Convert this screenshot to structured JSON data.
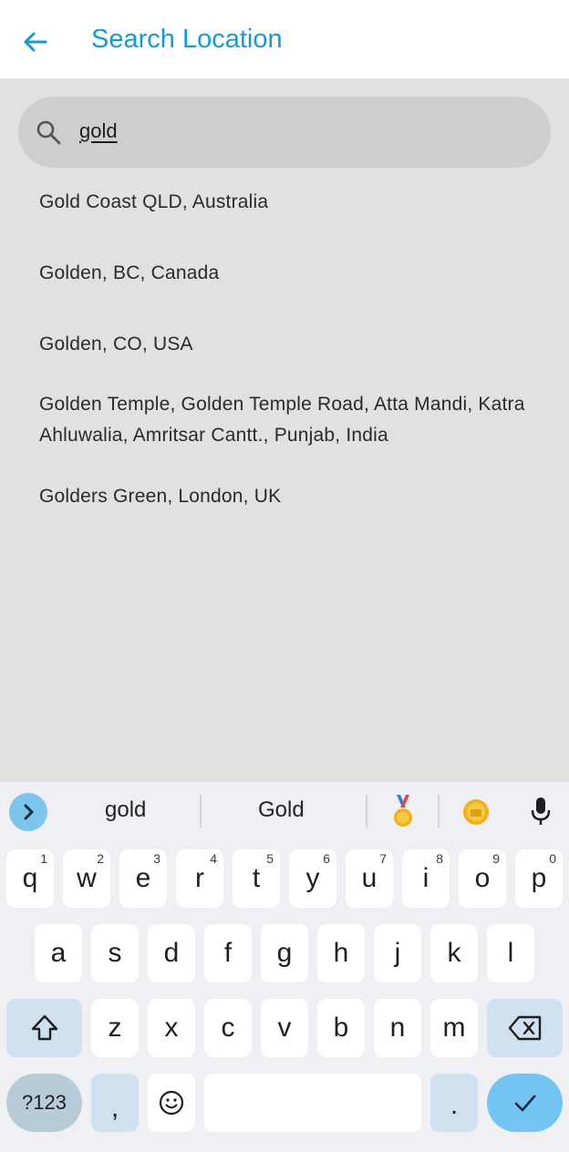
{
  "header": {
    "title": "Search Location"
  },
  "search": {
    "value": "gold"
  },
  "results": [
    "Gold Coast QLD, Australia",
    "Golden, BC, Canada",
    "Golden, CO, USA",
    "Golden Temple, Golden Temple Road, Atta Mandi, Katra Ahluwalia, Amritsar Cantt., Punjab, India",
    "Golders Green, London, UK"
  ],
  "keyboard": {
    "suggestions": [
      "gold",
      "Gold"
    ],
    "row1": [
      {
        "k": "q",
        "h": "1"
      },
      {
        "k": "w",
        "h": "2"
      },
      {
        "k": "e",
        "h": "3"
      },
      {
        "k": "r",
        "h": "4"
      },
      {
        "k": "t",
        "h": "5"
      },
      {
        "k": "y",
        "h": "6"
      },
      {
        "k": "u",
        "h": "7"
      },
      {
        "k": "i",
        "h": "8"
      },
      {
        "k": "o",
        "h": "9"
      },
      {
        "k": "p",
        "h": "0"
      }
    ],
    "row2": [
      "a",
      "s",
      "d",
      "f",
      "g",
      "h",
      "j",
      "k",
      "l"
    ],
    "row3": [
      "z",
      "x",
      "c",
      "v",
      "b",
      "n",
      "m"
    ],
    "sym_label": "?123",
    "comma": ",",
    "period": ".",
    "colors": {
      "accent": "#139bd8",
      "enter": "#74c4f3",
      "modifier": "#cfe0ef"
    }
  }
}
